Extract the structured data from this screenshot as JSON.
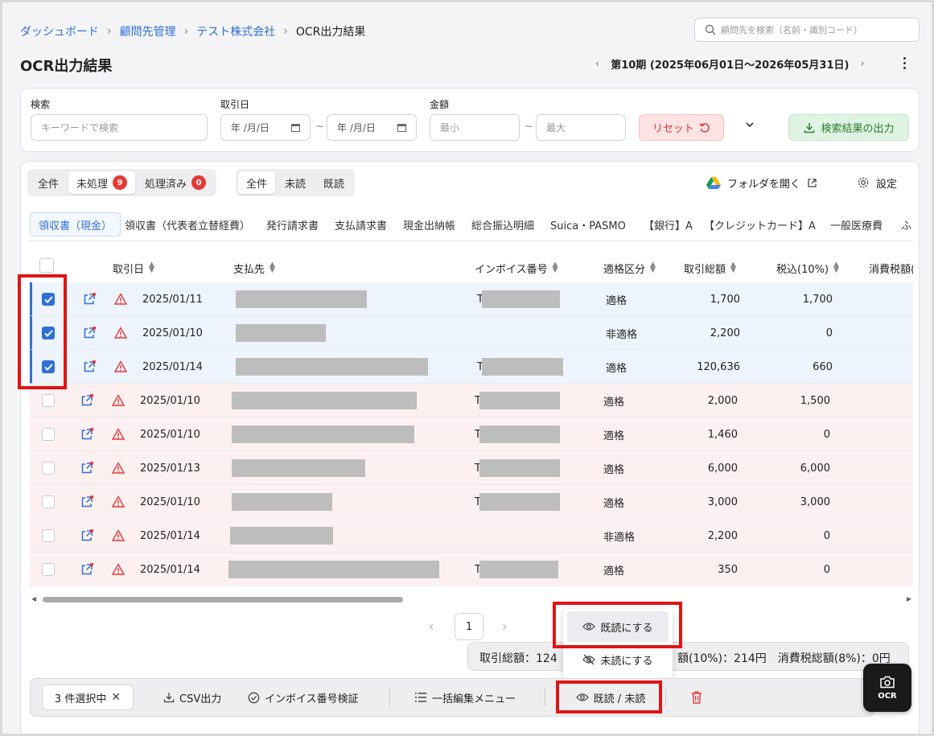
{
  "breadcrumb": [
    "ダッシュボード",
    "顧問先管理",
    "テスト株式会社",
    "OCR出力結果"
  ],
  "breadcrumb_sep": "›",
  "search": {
    "placeholder": "顧問先を検索（名前・識別コード）"
  },
  "page_title": "OCR出力結果",
  "period": {
    "label": "第10期 (2025年06月01日〜2026年05月31日)"
  },
  "filters": {
    "search_label": "検索",
    "search_placeholder": "キーワードで検索",
    "date_label": "取引日",
    "date_placeholder": "年 /月/日",
    "range_sep": "~",
    "amount_label": "金額",
    "min_placeholder": "最小",
    "max_placeholder": "最大",
    "reset_label": "リセット",
    "export_label": "検索結果の出力"
  },
  "status_seg": [
    {
      "label": "全件"
    },
    {
      "label": "未処理",
      "count": "9"
    },
    {
      "label": "処理済み",
      "count": "0"
    }
  ],
  "read_seg": [
    "全件",
    "未読",
    "既読"
  ],
  "folder_label": "フォルダを開く",
  "settings_label": "設定",
  "tabs": [
    "領収書（現金）",
    "領収書（代表者立替経費）",
    "発行請求書",
    "支払請求書",
    "現金出納帳",
    "総合振込明細",
    "Suica・PASMO",
    "【銀行】A",
    "【クレジットカード】A",
    "一般医療費",
    "ふ"
  ],
  "columns": {
    "date": "取引日",
    "payee": "支払先",
    "invoice": "インボイス番号",
    "eligibility": "適格区分",
    "total": "取引総額",
    "tax10": "税込(10%)",
    "consumption": "消費税額("
  },
  "rows": [
    {
      "date": "2025/01/11",
      "invoice_prefix": "T",
      "eligibility": "適格",
      "total": "1,700",
      "tax10": "1,700",
      "checked": true
    },
    {
      "date": "2025/01/10",
      "invoice_prefix": "",
      "eligibility": "非適格",
      "total": "2,200",
      "tax10": "0",
      "checked": true
    },
    {
      "date": "2025/01/14",
      "invoice_prefix": "T",
      "eligibility": "適格",
      "total": "120,636",
      "tax10": "660",
      "checked": true
    },
    {
      "date": "2025/01/10",
      "invoice_prefix": "T",
      "eligibility": "適格",
      "total": "2,000",
      "tax10": "1,500",
      "checked": false
    },
    {
      "date": "2025/01/10",
      "invoice_prefix": "T",
      "eligibility": "適格",
      "total": "1,460",
      "tax10": "0",
      "checked": false
    },
    {
      "date": "2025/01/13",
      "invoice_prefix": "T",
      "eligibility": "適格",
      "total": "6,000",
      "tax10": "6,000",
      "checked": false
    },
    {
      "date": "2025/01/10",
      "invoice_prefix": "T",
      "eligibility": "適格",
      "total": "3,000",
      "tax10": "3,000",
      "checked": false
    },
    {
      "date": "2025/01/14",
      "invoice_prefix": "",
      "eligibility": "非適格",
      "total": "2,200",
      "tax10": "0",
      "checked": false
    },
    {
      "date": "2025/01/14",
      "invoice_prefix": "T",
      "eligibility": "適格",
      "total": "350",
      "tax10": "0",
      "checked": false
    }
  ],
  "pagination": {
    "current": "1"
  },
  "summary": {
    "left": "取引総額：124",
    "right": "額(10%)：214円　消費税総額(8%)：0円"
  },
  "dropdown": {
    "mark_read": "既読にする",
    "mark_unread": "未読にする"
  },
  "bulk_bar": {
    "selected": "3 件選択中",
    "csv": "CSV出力",
    "invoice_check": "インボイス番号検証",
    "bulk_edit": "一括編集メニュー",
    "read_toggle": "既読 / 未読"
  },
  "ocr_fab": "OCR",
  "colors": {
    "accent": "#2d6fd6",
    "selected_row": "#eef4fd",
    "unprocessed_row": "#fdf0f0",
    "reset_bg": "#fde3e3",
    "export_bg": "#def3e1",
    "highlight": "#e01414"
  }
}
